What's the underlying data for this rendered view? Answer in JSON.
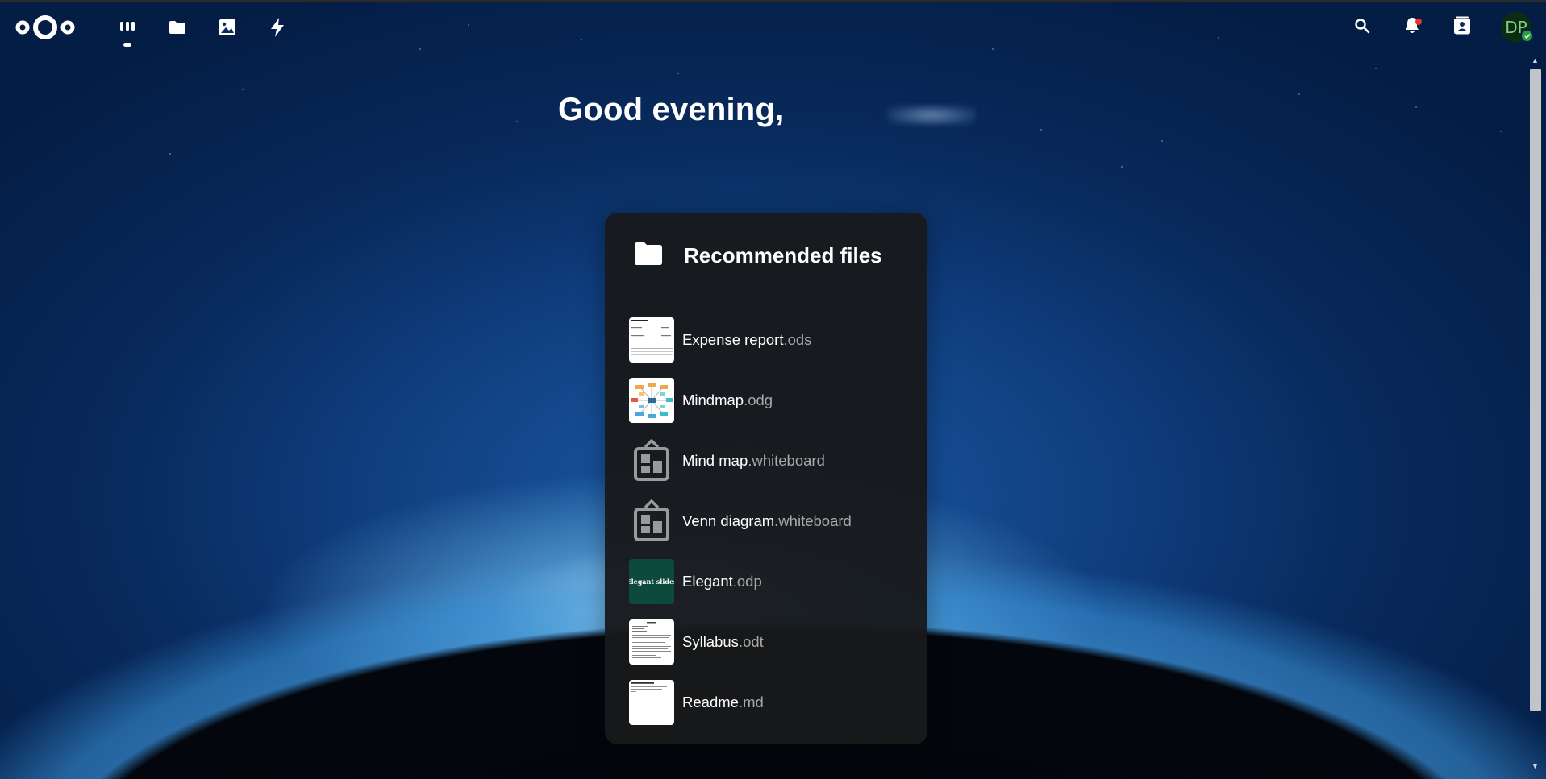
{
  "header": {
    "logo_alt": "Nextcloud",
    "apps": [
      {
        "name": "Dashboard",
        "icon": "dashboard-icon",
        "active": true
      },
      {
        "name": "Files",
        "icon": "folder-icon",
        "active": false
      },
      {
        "name": "Photos",
        "icon": "image-icon",
        "active": false
      },
      {
        "name": "Activity",
        "icon": "lightning-icon",
        "active": false
      }
    ],
    "right_icons": [
      "search-icon",
      "bell-icon",
      "contacts-icon"
    ],
    "avatar_initials": "DP",
    "notification_color": "#e9322d",
    "status_color": "#2d9e3c"
  },
  "greeting": {
    "text": "Good evening,"
  },
  "widget": {
    "title": "Recommended files",
    "icon": "folder-icon",
    "files": [
      {
        "name": "Expense report",
        "ext": ".ods",
        "thumb": "spreadsheet"
      },
      {
        "name": "Mindmap",
        "ext": ".odg",
        "thumb": "mindmap"
      },
      {
        "name": "Mind map",
        "ext": ".whiteboard",
        "thumb": "whiteboard"
      },
      {
        "name": "Venn diagram",
        "ext": ".whiteboard",
        "thumb": "whiteboard"
      },
      {
        "name": "Elegant",
        "ext": ".odp",
        "thumb": "slides",
        "thumb_text": "Elegant slides"
      },
      {
        "name": "Syllabus",
        "ext": ".odt",
        "thumb": "document"
      },
      {
        "name": "Readme",
        "ext": ".md",
        "thumb": "markdown"
      }
    ]
  }
}
